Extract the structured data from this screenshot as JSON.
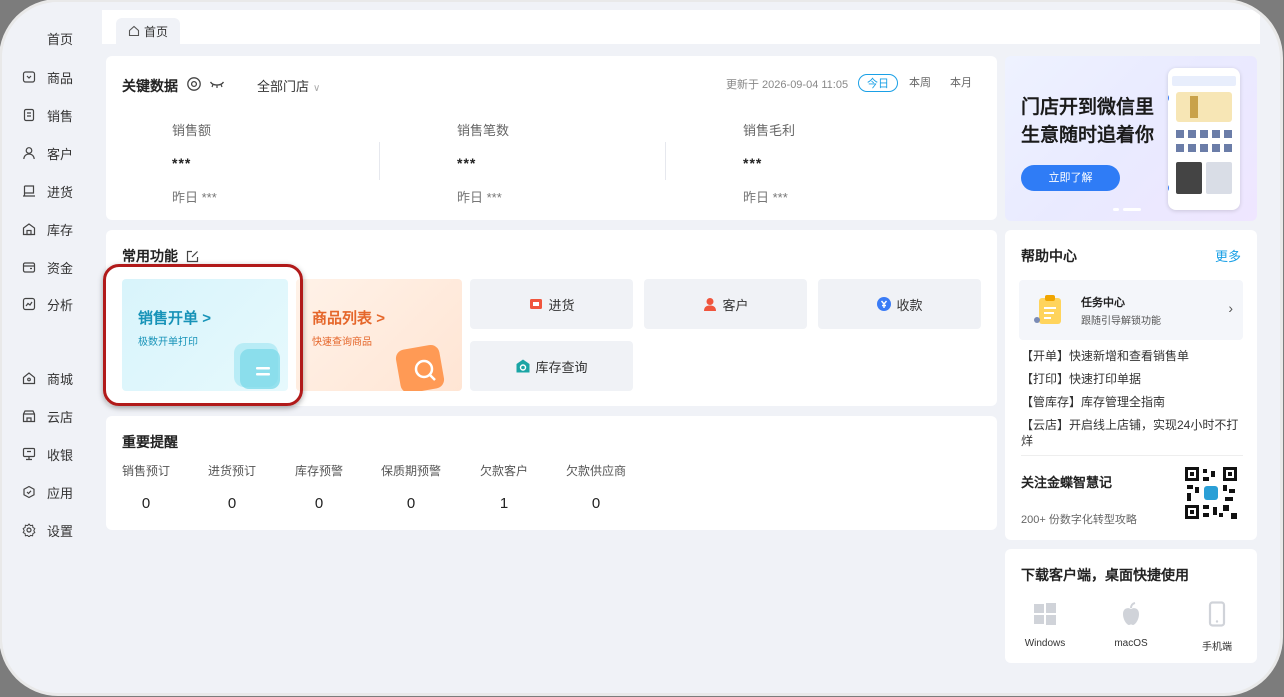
{
  "sidebar": {
    "items": [
      {
        "label": "首页",
        "icon": "home-icon"
      },
      {
        "label": "商品",
        "icon": "goods-icon"
      },
      {
        "label": "销售",
        "icon": "sales-icon"
      },
      {
        "label": "客户",
        "icon": "user-icon"
      },
      {
        "label": "进货",
        "icon": "purchase-icon"
      },
      {
        "label": "库存",
        "icon": "warehouse-icon"
      },
      {
        "label": "资金",
        "icon": "wallet-icon"
      },
      {
        "label": "分析",
        "icon": "chart-icon"
      },
      {
        "label": "商城",
        "icon": "mall-icon"
      },
      {
        "label": "云店",
        "icon": "cloud-store-icon"
      },
      {
        "label": "收银",
        "icon": "cashier-icon"
      },
      {
        "label": "应用",
        "icon": "app-icon"
      },
      {
        "label": "设置",
        "icon": "settings-icon"
      }
    ]
  },
  "tabs": [
    {
      "label": "首页"
    }
  ],
  "key_data": {
    "title": "关键数据",
    "store_filter": "全部门店",
    "updated": "更新于 2026-09-04 11:05",
    "ranges": [
      "今日",
      "本周",
      "本月"
    ],
    "active_range": "今日",
    "metrics": [
      {
        "label": "销售额",
        "value": "***",
        "yesterday": "昨日 ***"
      },
      {
        "label": "销售笔数",
        "value": "***",
        "yesterday": "昨日 ***"
      },
      {
        "label": "销售毛利",
        "value": "***",
        "yesterday": "昨日 ***"
      }
    ]
  },
  "common": {
    "title": "常用功能",
    "sales_order": {
      "title": "销售开单",
      "arrow": ">",
      "subtitle": "极数开单打印"
    },
    "goods_list": {
      "title": "商品列表",
      "arrow": ">",
      "subtitle": "快速查询商品"
    },
    "tiles": [
      {
        "label": "进货",
        "icon": "purchase-icon",
        "color": "#f0553d"
      },
      {
        "label": "客户",
        "icon": "customer-icon",
        "color": "#f0553d"
      },
      {
        "label": "收款",
        "icon": "payment-icon",
        "color": "#3b7cf6"
      },
      {
        "label": "库存查询",
        "icon": "inventory-icon",
        "color": "#1aa5a5"
      }
    ]
  },
  "reminders": {
    "title": "重要提醒",
    "items": [
      {
        "label": "销售预订",
        "value": "0"
      },
      {
        "label": "进货预订",
        "value": "0"
      },
      {
        "label": "库存预警",
        "value": "0"
      },
      {
        "label": "保质期预警",
        "value": "0"
      },
      {
        "label": "欠款客户",
        "value": "1"
      },
      {
        "label": "欠款供应商",
        "value": "0"
      }
    ]
  },
  "banner": {
    "line1": "门店开到微信里",
    "line2": "生意随时追着你",
    "button": "立即了解"
  },
  "help": {
    "title": "帮助中心",
    "more": "更多",
    "task_title": "任务中心",
    "task_subtitle": "跟随引导解锁功能",
    "links": [
      "【开单】快速新增和查看销售单",
      "【打印】快速打印单据",
      "【管库存】库存管理全指南",
      "【云店】开启线上店铺，实现24小时不打烊"
    ],
    "follow_title": "关注金蝶智慧记",
    "follow_subtitle": "200+ 份数字化转型攻略"
  },
  "download": {
    "title": "下载客户端，桌面快捷使用",
    "items": [
      {
        "label": "Windows",
        "icon": "windows-icon"
      },
      {
        "label": "macOS",
        "icon": "apple-icon"
      },
      {
        "label": "手机端",
        "icon": "mobile-icon"
      }
    ]
  },
  "colors": {
    "accent": "#1aa0e6",
    "highlight_border": "#b11a1a",
    "sales_tile": "#1793b8",
    "goods_tile": "#e5662a"
  }
}
